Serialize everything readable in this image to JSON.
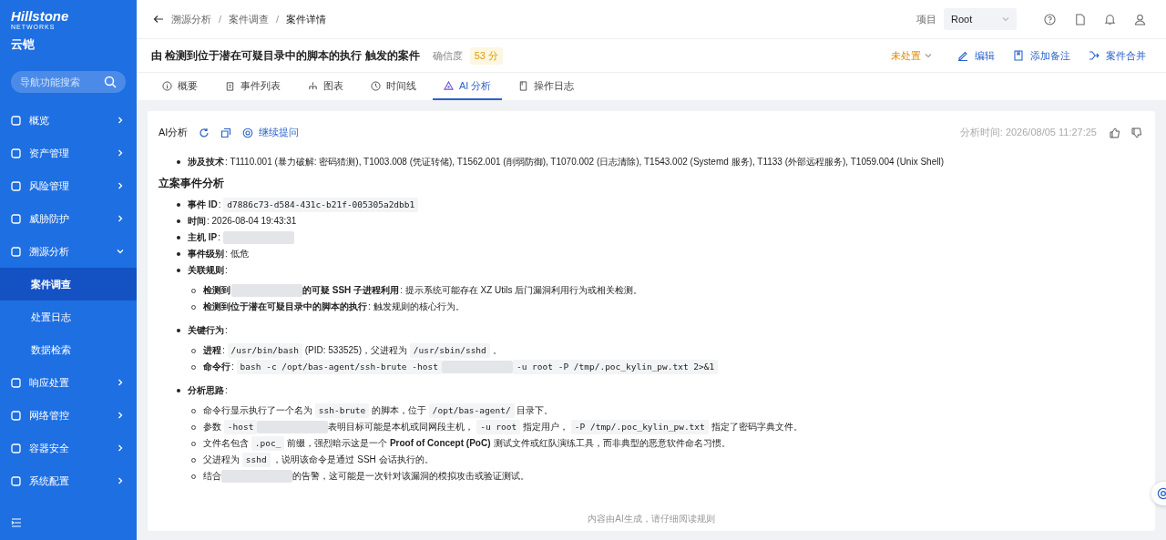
{
  "sidebar": {
    "brand": "Hillstone",
    "brand_sub": "NETWORKS",
    "product": "云铠",
    "search": {
      "placeholder": "导航功能搜索"
    },
    "items": [
      {
        "label": "概览",
        "expanded": false
      },
      {
        "label": "资产管理",
        "expanded": false
      },
      {
        "label": "风险管理",
        "expanded": false
      },
      {
        "label": "威胁防护",
        "expanded": false
      },
      {
        "label": "溯源分析",
        "expanded": true,
        "children": [
          {
            "label": "案件调查",
            "selected": true
          },
          {
            "label": "处置日志",
            "selected": false
          },
          {
            "label": "数据检索",
            "selected": false
          }
        ]
      },
      {
        "label": "响应处置",
        "expanded": false
      },
      {
        "label": "网络管控",
        "expanded": false
      },
      {
        "label": "容器安全",
        "expanded": false
      },
      {
        "label": "系统配置",
        "expanded": false
      }
    ]
  },
  "header": {
    "separator": "/",
    "breadcrumbs": [
      "溯源分析",
      "案件调查",
      "案件详情"
    ],
    "project_label": "项目",
    "project": "Root"
  },
  "case": {
    "title": "由 检测到位于潜在可疑目录中的脚本的执行 触发的案件",
    "confidence_label": "确信度",
    "confidence": "53 分",
    "status": "未处置",
    "actions": [
      {
        "kind": "edit",
        "label": "编辑"
      },
      {
        "kind": "note",
        "label": "添加备注"
      },
      {
        "kind": "merge",
        "label": "案件合并"
      }
    ]
  },
  "tabs": [
    {
      "kind": "info",
      "label": "概要",
      "selected": false
    },
    {
      "kind": "list",
      "label": "事件列表",
      "selected": false
    },
    {
      "kind": "graph",
      "label": "图表",
      "selected": false
    },
    {
      "kind": "clock",
      "label": "时间线",
      "selected": false
    },
    {
      "kind": "ai",
      "label": "AI 分析",
      "selected": true
    },
    {
      "kind": "log",
      "label": "操作日志",
      "selected": false
    }
  ],
  "panel": {
    "title": "AI分析",
    "ask": "继续提问",
    "time": "分析时间: 2026/08/05 11:27:25",
    "footer": "内容由AI生成，请仔细阅读规则"
  },
  "blocks": [
    {
      "kind": "bullet",
      "parts": [
        {
          "kind": "bold",
          "text": "涉及技术"
        },
        {
          "kind": "text",
          "text": ": T1110.001 (暴力破解: 密码猜测), T1003.008 (凭证转储), T1562.001 (削弱防御), T1070.002 (日志清除), T1543.002 (Systemd 服务), T1133 (外部远程服务), T1059.004 (Unix Shell)"
        }
      ]
    },
    {
      "kind": "heading",
      "text": "立案事件分析"
    },
    {
      "kind": "bullet",
      "parts": [
        {
          "kind": "bold",
          "text": "事件 ID"
        },
        {
          "kind": "text",
          "text": ": "
        },
        {
          "kind": "code",
          "text": "d7886c73-d584-431c-b21f-005305a2dbb1"
        }
      ]
    },
    {
      "kind": "bullet",
      "parts": [
        {
          "kind": "bold",
          "text": "时间"
        },
        {
          "kind": "text",
          "text": ": 2026-08-04 19:43:31"
        }
      ]
    },
    {
      "kind": "bullet",
      "parts": [
        {
          "kind": "bold",
          "text": "主机 IP"
        },
        {
          "kind": "text",
          "text": ": "
        },
        {
          "kind": "redacted"
        }
      ]
    },
    {
      "kind": "bullet",
      "parts": [
        {
          "kind": "bold",
          "text": "事件级别"
        },
        {
          "kind": "text",
          "text": ": 低危"
        }
      ]
    },
    {
      "kind": "bullet",
      "parts": [
        {
          "kind": "bold",
          "text": "关联规则"
        },
        {
          "kind": "text",
          "text": ":"
        }
      ],
      "children": [
        {
          "parts": [
            {
              "kind": "bold",
              "text": "检测到"
            },
            {
              "kind": "redacted"
            },
            {
              "kind": "bold",
              "text": "的可疑 SSH 子进程利用"
            },
            {
              "kind": "text",
              "text": ": 提示系统可能存在 XZ Utils 后门漏洞利用行为或相关检测。"
            }
          ]
        },
        {
          "parts": [
            {
              "kind": "bold",
              "text": "检测到位于潜在可疑目录中的脚本的执行"
            },
            {
              "kind": "text",
              "text": ": 触发规则的核心行为。"
            }
          ]
        }
      ]
    },
    {
      "kind": "bullet",
      "parts": [
        {
          "kind": "bold",
          "text": "关键行为"
        },
        {
          "kind": "text",
          "text": ":"
        }
      ],
      "children": [
        {
          "parts": [
            {
              "kind": "bold",
              "text": "进程"
            },
            {
              "kind": "text",
              "text": ": "
            },
            {
              "kind": "code",
              "text": "/usr/bin/bash"
            },
            {
              "kind": "text",
              "text": " (PID: 533525)，父进程为 "
            },
            {
              "kind": "code",
              "text": "/usr/sbin/sshd"
            },
            {
              "kind": "text",
              "text": " 。"
            }
          ]
        },
        {
          "parts": [
            {
              "kind": "bold",
              "text": "命令行"
            },
            {
              "kind": "text",
              "text": ": "
            },
            {
              "kind": "code",
              "text": "bash -c /opt/bas-agent/ssh-brute -host"
            },
            {
              "kind": "redacted"
            },
            {
              "kind": "code",
              "text": "-u root -P /tmp/.poc_kylin_pw.txt 2>&1"
            }
          ]
        }
      ]
    },
    {
      "kind": "bullet",
      "parts": [
        {
          "kind": "bold",
          "text": "分析思路"
        },
        {
          "kind": "text",
          "text": ":"
        }
      ],
      "children": [
        {
          "parts": [
            {
              "kind": "text",
              "text": "命令行显示执行了一个名为 "
            },
            {
              "kind": "code",
              "text": "ssh-brute"
            },
            {
              "kind": "text",
              "text": " 的脚本，位于 "
            },
            {
              "kind": "code",
              "text": "/opt/bas-agent/"
            },
            {
              "kind": "text",
              "text": " 目录下。"
            }
          ]
        },
        {
          "parts": [
            {
              "kind": "text",
              "text": "参数 "
            },
            {
              "kind": "code",
              "text": "-host"
            },
            {
              "kind": "redacted"
            },
            {
              "kind": "text",
              "text": "表明目标可能是本机或同网段主机， "
            },
            {
              "kind": "code",
              "text": "-u root"
            },
            {
              "kind": "text",
              "text": " 指定用户， "
            },
            {
              "kind": "code",
              "text": "-P /tmp/.poc_kylin_pw.txt"
            },
            {
              "kind": "text",
              "text": " 指定了密码字典文件。"
            }
          ]
        },
        {
          "parts": [
            {
              "kind": "text",
              "text": "文件名包含 "
            },
            {
              "kind": "code",
              "text": ".poc_"
            },
            {
              "kind": "text",
              "text": " 前缀，强烈暗示这是一个 "
            },
            {
              "kind": "bold",
              "text": "Proof of Concept (PoC)"
            },
            {
              "kind": "text",
              "text": " 测试文件或红队演练工具，而非典型的恶意软件命名习惯。"
            }
          ]
        },
        {
          "parts": [
            {
              "kind": "text",
              "text": "父进程为 "
            },
            {
              "kind": "code",
              "text": "sshd"
            },
            {
              "kind": "text",
              "text": " ，说明该命令是通过 SSH 会话执行的。"
            }
          ]
        },
        {
          "parts": [
            {
              "kind": "text",
              "text": "结合"
            },
            {
              "kind": "redacted"
            },
            {
              "kind": "text",
              "text": "的告警，这可能是一次针对该漏洞的模拟攻击或验证测试。"
            }
          ]
        }
      ]
    }
  ]
}
